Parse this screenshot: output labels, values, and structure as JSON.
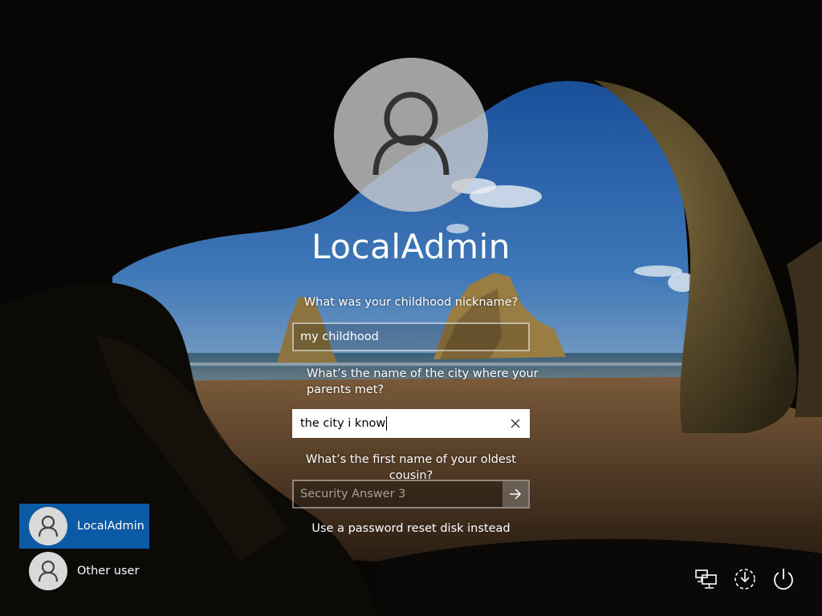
{
  "user": {
    "name": "LocalAdmin"
  },
  "security_questions": [
    {
      "question": "What was your childhood nickname?",
      "answer": "my childhood"
    },
    {
      "question": "What’s the name of the city where your parents met?",
      "answer": "the city i know"
    },
    {
      "question": "What’s the first name of your oldest cousin?",
      "answer": "",
      "placeholder": "Security Answer 3"
    }
  ],
  "reset_link_label": "Use a password reset disk instead",
  "user_list": [
    {
      "label": "LocalAdmin",
      "selected": true
    },
    {
      "label": "Other user",
      "selected": false
    }
  ],
  "icons": {
    "clear": "close-icon",
    "submit": "arrow-right-icon",
    "network": "network-icon",
    "ease_of_access": "ease-of-access-icon",
    "power": "power-icon",
    "avatar": "user-icon"
  },
  "colors": {
    "selected_tile": "#0b5aa6",
    "avatar_bg": "#d9d9d9"
  }
}
